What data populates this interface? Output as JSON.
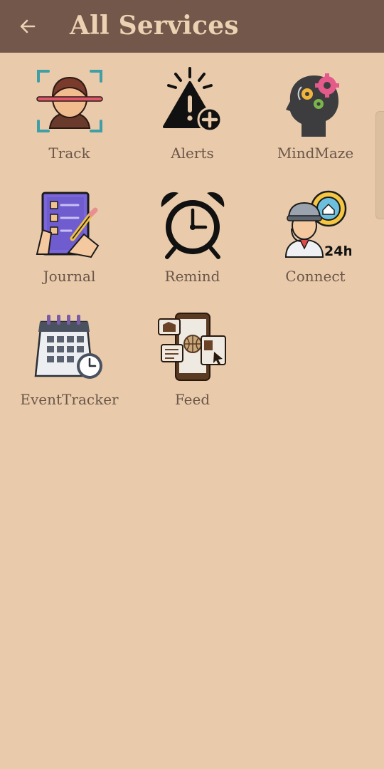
{
  "header": {
    "title": "All Services",
    "back_icon": "arrow-left-icon"
  },
  "services": [
    {
      "label": "Track",
      "icon": "face-scan-icon"
    },
    {
      "label": "Alerts",
      "icon": "alert-add-icon"
    },
    {
      "label": "MindMaze",
      "icon": "brain-gears-icon"
    },
    {
      "label": "Journal",
      "icon": "journal-checklist-icon"
    },
    {
      "label": "Remind",
      "icon": "alarm-clock-icon"
    },
    {
      "label": "Connect",
      "icon": "support-24h-icon"
    },
    {
      "label": "EventTracker",
      "icon": "calendar-clock-icon"
    },
    {
      "label": "Feed",
      "icon": "phone-feed-icon"
    }
  ],
  "colors": {
    "appbar": "#73574a",
    "background": "#e9cbab",
    "title": "#ecd2b2",
    "label": "#6b5648"
  }
}
